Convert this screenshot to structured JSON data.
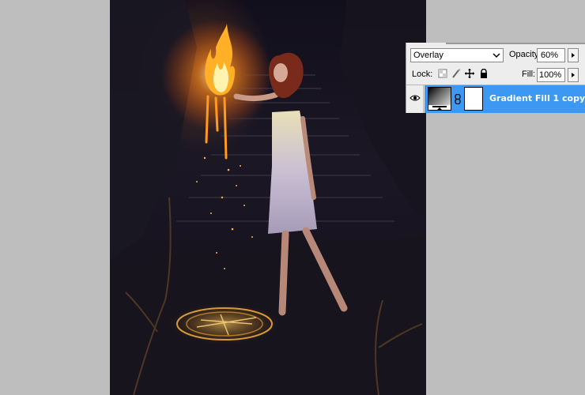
{
  "layers_panel": {
    "blend_mode": "Overlay",
    "opacity_label": "Opacity:",
    "opacity_value": "60%",
    "lock_label": "Lock:",
    "fill_label": "Fill:",
    "fill_value": "100%",
    "lock_icons": [
      "lock-transparent-icon",
      "lock-paint-icon",
      "lock-move-icon",
      "lock-all-icon"
    ],
    "layer": {
      "name": "Gradient Fill 1 copy",
      "visible": true,
      "selected": true,
      "icons": [
        "eye-icon",
        "gradient-thumbnail",
        "chain-link-icon",
        "mask-thumbnail"
      ]
    }
  },
  "colors": {
    "selection": "#3d98f3",
    "workspace": "#bebebe",
    "panel": "#ededed"
  }
}
